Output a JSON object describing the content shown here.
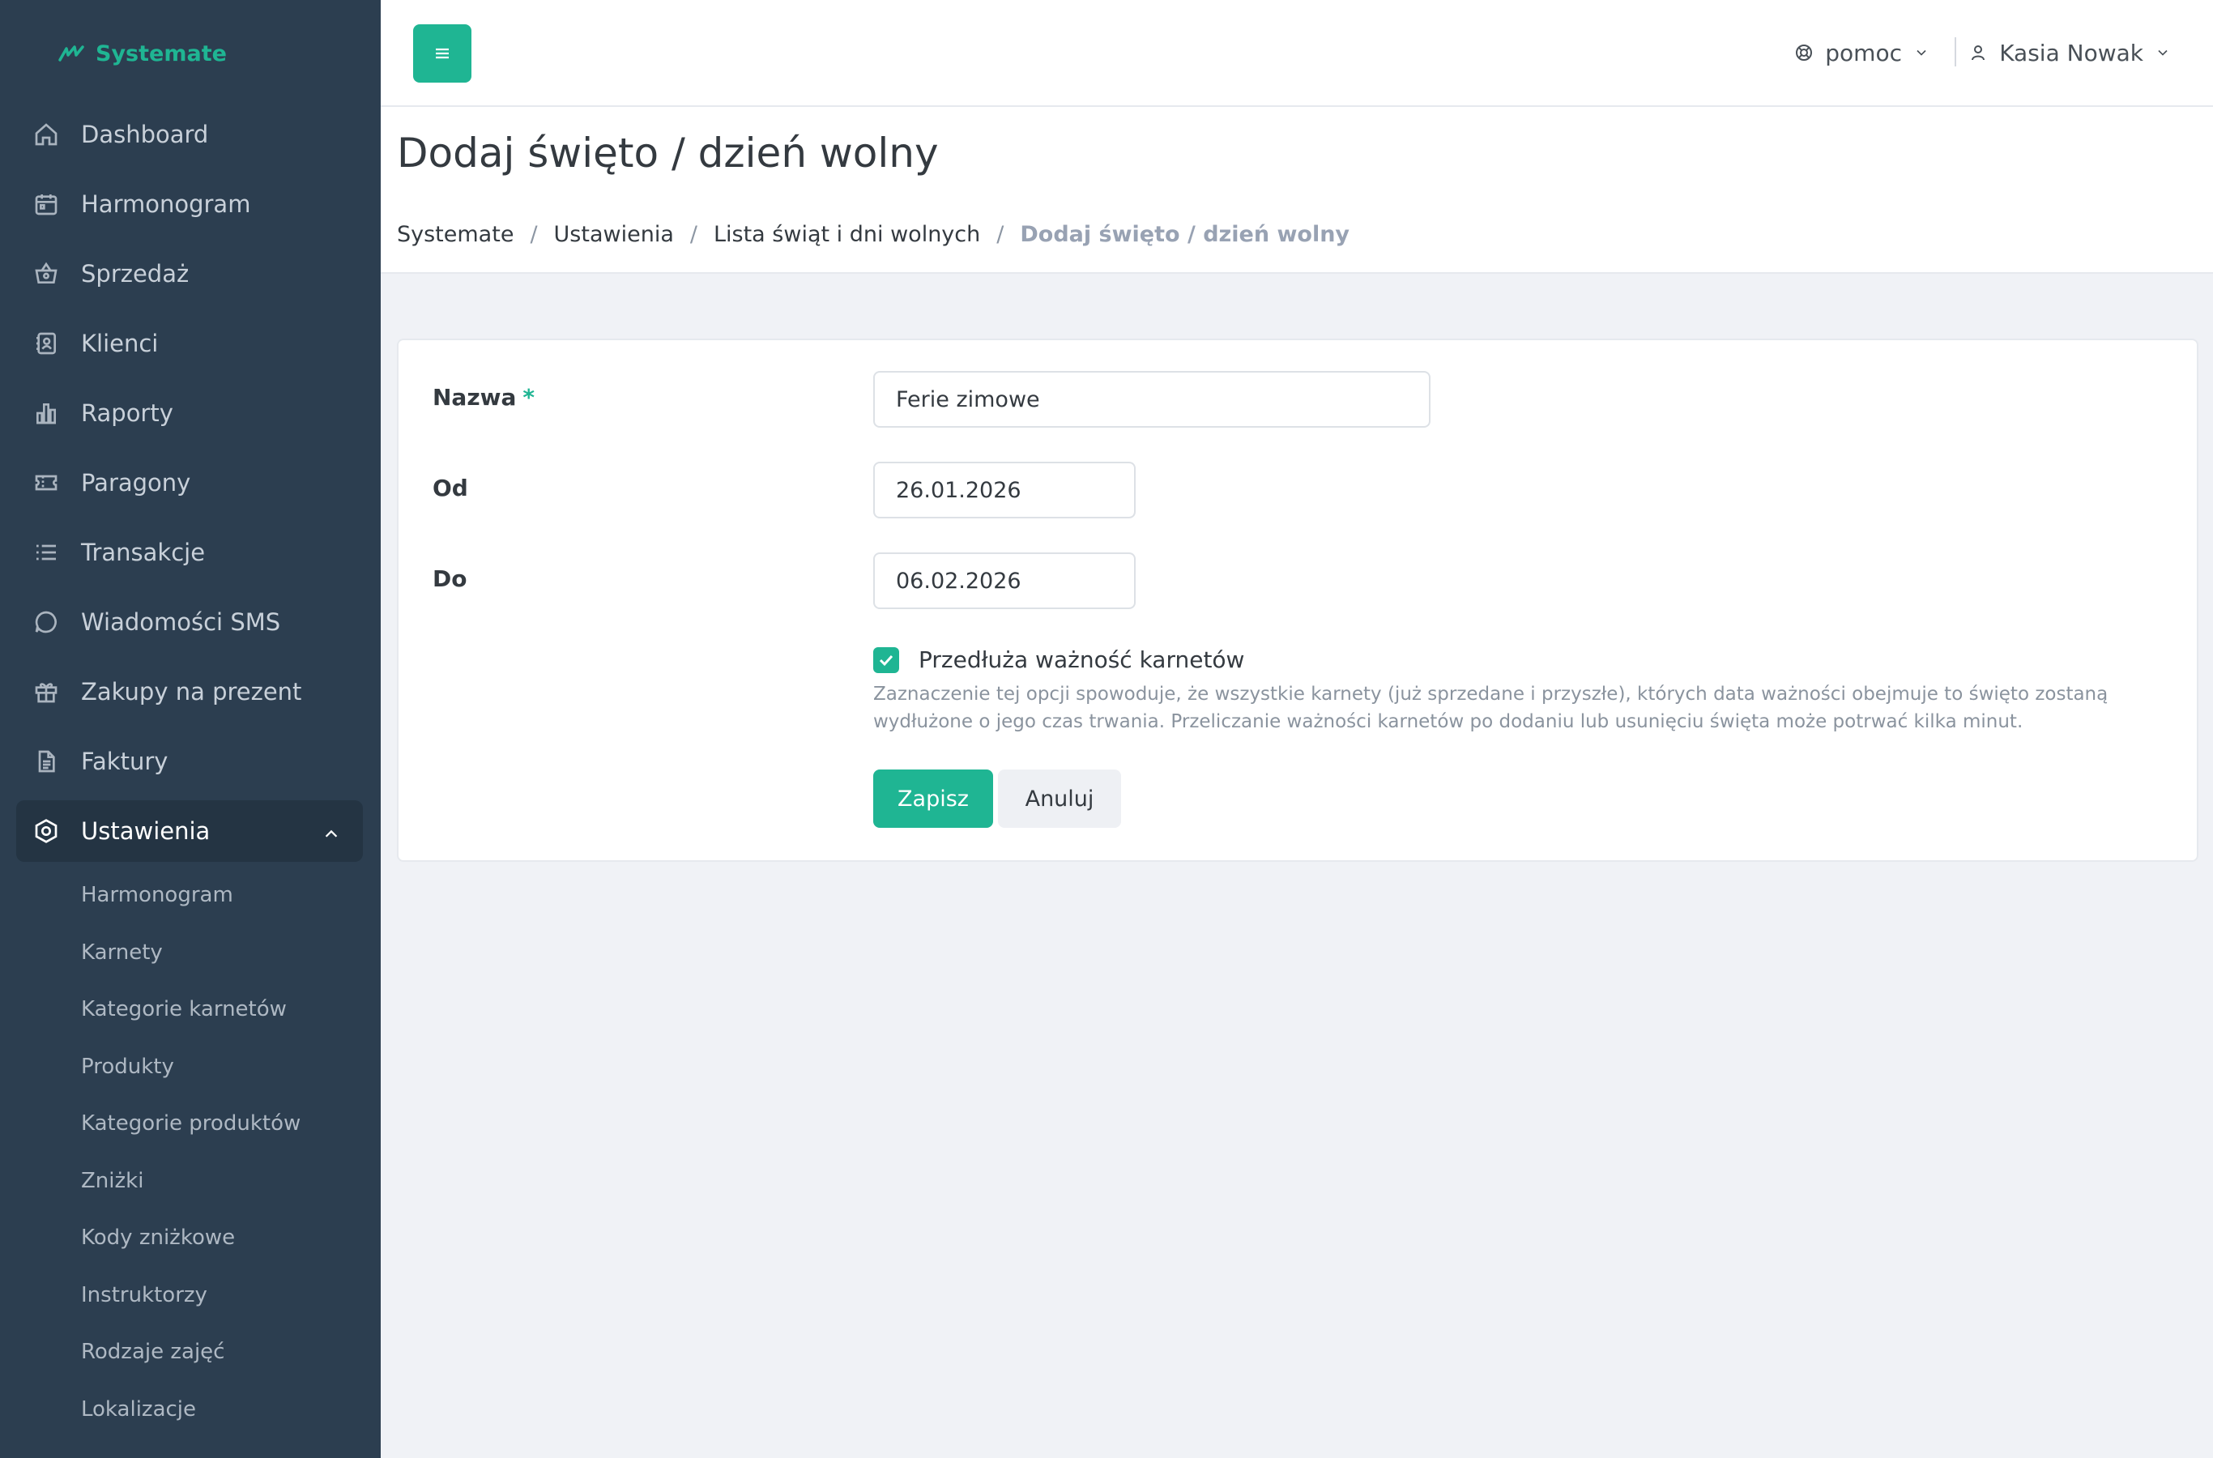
{
  "brand": {
    "name": "Systemate"
  },
  "sidebar": {
    "items": [
      {
        "label": "Dashboard",
        "icon": "home-icon"
      },
      {
        "label": "Harmonogram",
        "icon": "calendar-icon"
      },
      {
        "label": "Sprzedaż",
        "icon": "basket-icon"
      },
      {
        "label": "Klienci",
        "icon": "contacts-icon"
      },
      {
        "label": "Raporty",
        "icon": "bar-chart-icon"
      },
      {
        "label": "Paragony",
        "icon": "ticket-icon"
      },
      {
        "label": "Transakcje",
        "icon": "list-icon"
      },
      {
        "label": "Wiadomości SMS",
        "icon": "chat-icon"
      },
      {
        "label": "Zakupy na prezent",
        "icon": "gift-icon"
      },
      {
        "label": "Faktury",
        "icon": "document-icon"
      },
      {
        "label": "Ustawienia",
        "icon": "settings-icon",
        "active": true
      }
    ],
    "subitems": [
      "Harmonogram",
      "Karnety",
      "Kategorie karnetów",
      "Produkty",
      "Kategorie produktów",
      "Zniżki",
      "Kody zniżkowe",
      "Instruktorzy",
      "Rodzaje zajęć",
      "Lokalizacje"
    ]
  },
  "header": {
    "help_label": "pomoc",
    "user_name": "Kasia Nowak"
  },
  "page": {
    "title": "Dodaj święto / dzień wolny",
    "breadcrumb": [
      "Systemate",
      "Ustawienia",
      "Lista świąt i dni wolnych",
      "Dodaj święto / dzień wolny"
    ]
  },
  "form": {
    "name_label": "Nazwa",
    "required_mark": "*",
    "name_value": "Ferie zimowe",
    "from_label": "Od",
    "from_value": "26.01.2026",
    "to_label": "Do",
    "to_value": "06.02.2026",
    "extend_label": "Przedłuża ważność karnetów",
    "extend_checked": true,
    "extend_hint": "Zaznaczenie tej opcji spowoduje, że wszystkie karnety (już sprzedane i przyszłe), których data ważności obejmuje to święto zostaną wydłużone o jego czas trwania. Przeliczanie ważności karnetów po dodaniu lub usunięciu święta może potrwać kilka minut.",
    "save_label": "Zapisz",
    "cancel_label": "Anuluj"
  },
  "colors": {
    "accent": "#1fb593",
    "sidebar_bg": "#2c3e50",
    "page_bg": "#f0f2f6"
  }
}
